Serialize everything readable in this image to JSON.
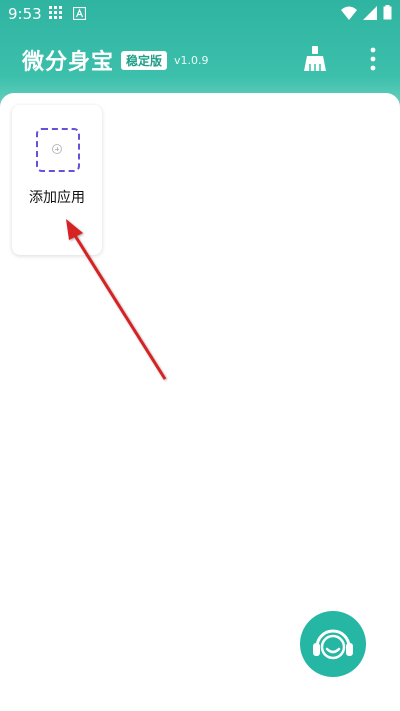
{
  "status_bar": {
    "time": "9:53"
  },
  "header": {
    "title": "微分身宝",
    "badge": "稳定版",
    "version": "v1.0.9"
  },
  "apps": {
    "add_label": "添加应用"
  },
  "icons": {
    "clean": "broom-icon",
    "more": "more-vertical-icon",
    "support": "headset-smile-icon"
  },
  "colors": {
    "header": "#2fb4a1",
    "support_button": "#25b7a3",
    "add_box_border": "#6a4fd8",
    "annotation_arrow": "#d62020"
  }
}
